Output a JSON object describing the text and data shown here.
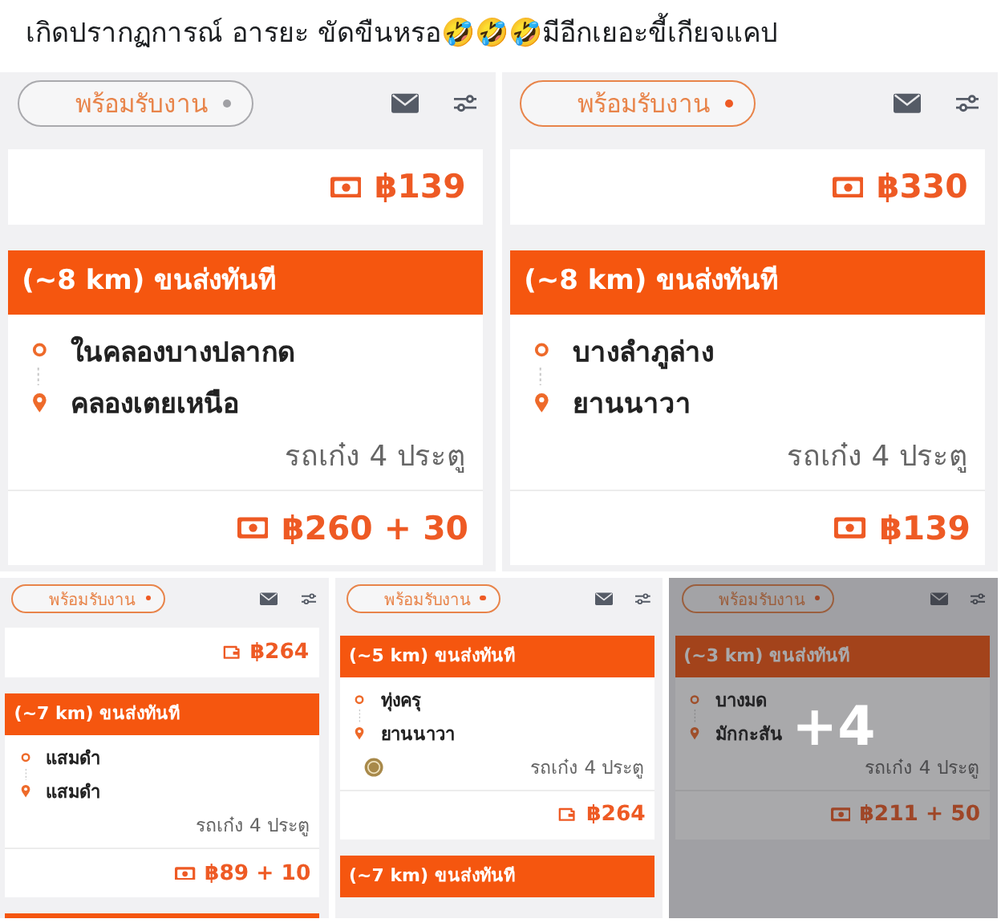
{
  "post": {
    "text": "เกิดปรากฏการณ์ อารยะ ขัดขืนหรอ🤣🤣🤣มีอีกเยอะขี้เกียจแคป"
  },
  "gallery": {
    "more_label": "+4",
    "tiles": [
      {
        "status": {
          "label": "พร้อมรับงาน",
          "online": false
        },
        "cards": [
          {
            "kind": "price",
            "price": "฿139"
          },
          {
            "kind": "job",
            "title": "(~8 km) ขนส่งทันที",
            "pickup": "ในคลองบางปลากด",
            "dropoff": "คลองเตยเหนือ",
            "vehicle": "รถเก๋ง 4 ประตู",
            "badge": false,
            "price": "฿260 + 30"
          }
        ]
      },
      {
        "status": {
          "label": "พร้อมรับงาน",
          "online": true
        },
        "cards": [
          {
            "kind": "price",
            "price": "฿330"
          },
          {
            "kind": "job",
            "title": "(~8 km) ขนส่งทันที",
            "pickup": "บางลำภูล่าง",
            "dropoff": "ยานนาวา",
            "vehicle": "รถเก๋ง 4 ประตู",
            "badge": false,
            "price": "฿139"
          }
        ]
      },
      {
        "status": {
          "label": "พร้อมรับงาน",
          "online": true
        },
        "cards": [
          {
            "kind": "price",
            "price": "฿264"
          },
          {
            "kind": "job",
            "title": "(~7 km) ขนส่งทันที",
            "pickup": "แสมดำ",
            "dropoff": "แสมดำ",
            "vehicle": "รถเก๋ง 4 ประตู",
            "badge": false,
            "price": "฿89 + 10"
          },
          {
            "kind": "stub"
          }
        ]
      },
      {
        "status": {
          "label": "พร้อมรับงาน",
          "online": true
        },
        "cards": [
          {
            "kind": "job",
            "title": "(~5 km) ขนส่งทันที",
            "pickup": "ทุ่งครุ",
            "dropoff": "ยานนาวา",
            "vehicle": "รถเก๋ง 4 ประตู",
            "badge": true,
            "price": "฿264"
          },
          {
            "kind": "stub",
            "title": "(~7 km) ขนส่งทันที"
          }
        ]
      },
      {
        "status": {
          "label": "พร้อมรับงาน",
          "online": true
        },
        "cards": [
          {
            "kind": "job",
            "title": "(~3 km) ขนส่งทันที",
            "pickup": "บางมด",
            "dropoff": "มักกะสัน",
            "vehicle": "รถเก๋ง 4 ประตู",
            "badge": false,
            "price": "฿211 + 50"
          }
        ]
      }
    ]
  }
}
